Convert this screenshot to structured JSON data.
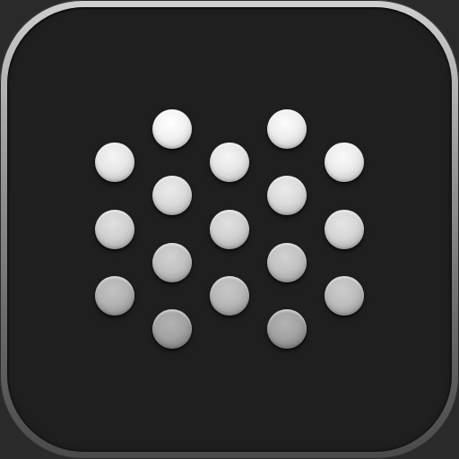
{
  "icon": {
    "name": "speaker-grille-app-icon",
    "colors": {
      "background": "#1f1f1f",
      "frame_light": "#cfcfcf",
      "frame_dark": "#4a4a4a"
    }
  },
  "dots": [
    {
      "id": "dot-r1-c2",
      "shade": 0.95
    },
    {
      "id": "dot-r1-c4",
      "shade": 0.93
    },
    {
      "id": "dot-r2-c1",
      "shade": 0.9
    },
    {
      "id": "dot-r2-c3",
      "shade": 0.9
    },
    {
      "id": "dot-r2-c5",
      "shade": 0.92
    },
    {
      "id": "dot-r3-c2",
      "shade": 0.86
    },
    {
      "id": "dot-r3-c4",
      "shade": 0.86
    },
    {
      "id": "dot-r4-c1",
      "shade": 0.82
    },
    {
      "id": "dot-r4-c3",
      "shade": 0.82
    },
    {
      "id": "dot-r4-c5",
      "shade": 0.84
    },
    {
      "id": "dot-r5-c2",
      "shade": 0.76
    },
    {
      "id": "dot-r5-c4",
      "shade": 0.76
    },
    {
      "id": "dot-r6-c1",
      "shade": 0.7
    },
    {
      "id": "dot-r6-c3",
      "shade": 0.72
    },
    {
      "id": "dot-r6-c5",
      "shade": 0.74
    },
    {
      "id": "dot-r7-c2",
      "shade": 0.64
    },
    {
      "id": "dot-r7-c4",
      "shade": 0.64
    }
  ]
}
